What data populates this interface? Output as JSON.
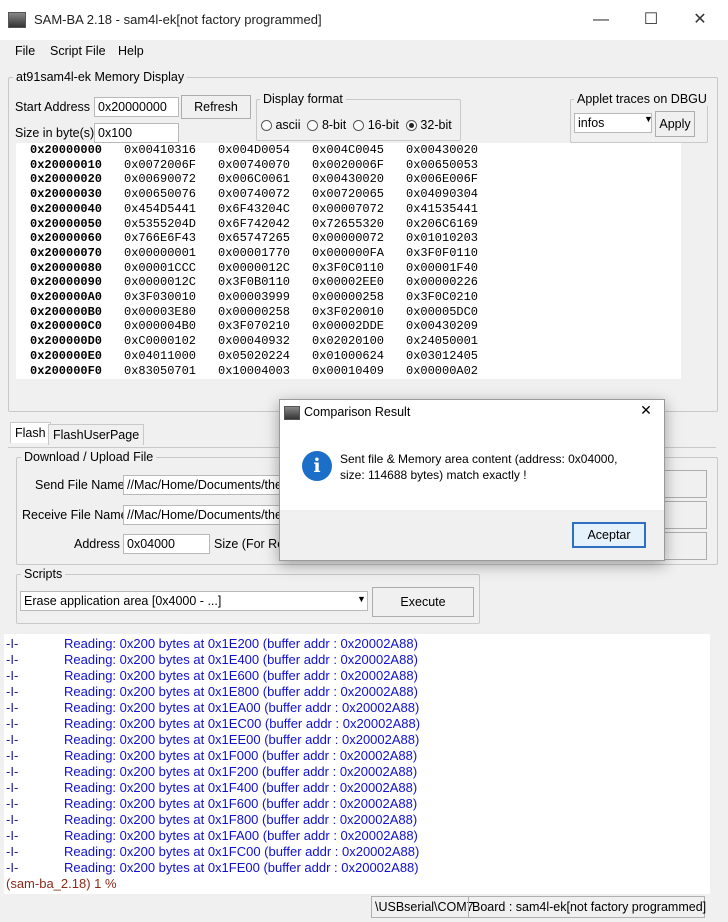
{
  "window": {
    "title": "SAM-BA 2.18  - sam4l-ek[not factory programmed]",
    "minimize_icon": "minimize-icon",
    "maximize_icon": "maximize-icon",
    "close_icon": "close-icon"
  },
  "menu": {
    "file": "File",
    "script_file": "Script File",
    "help": "Help"
  },
  "memory_display": {
    "legend": "at91sam4l-ek Memory Display",
    "start_address_label": "Start Address :",
    "start_address_value": "0x20000000",
    "size_label": "Size in byte(s) :",
    "size_value": "0x100",
    "refresh_label": "Refresh",
    "format_legend": "Display format",
    "formats": [
      "ascii",
      "8-bit",
      "16-bit",
      "32-bit"
    ],
    "selected_format": "32-bit",
    "applet_legend": "Applet traces on DBGU",
    "applet_value": "infos",
    "apply_label": "Apply",
    "rows": [
      {
        "addr": "0x20000000",
        "cells": [
          "0x00410316",
          "0x004D0054",
          "0x004C0045",
          "0x00430020"
        ]
      },
      {
        "addr": "0x20000010",
        "cells": [
          "0x0072006F",
          "0x00740070",
          "0x0020006F",
          "0x00650053"
        ]
      },
      {
        "addr": "0x20000020",
        "cells": [
          "0x00690072",
          "0x006C0061",
          "0x00430020",
          "0x006E006F"
        ]
      },
      {
        "addr": "0x20000030",
        "cells": [
          "0x00650076",
          "0x00740072",
          "0x00720065",
          "0x04090304"
        ]
      },
      {
        "addr": "0x20000040",
        "cells": [
          "0x454D5441",
          "0x6F43204C",
          "0x00007072",
          "0x41535441"
        ]
      },
      {
        "addr": "0x20000050",
        "cells": [
          "0x5355204D",
          "0x6F742042",
          "0x72655320",
          "0x206C6169"
        ]
      },
      {
        "addr": "0x20000060",
        "cells": [
          "0x766E6F43",
          "0x65747265",
          "0x00000072",
          "0x01010203"
        ]
      },
      {
        "addr": "0x20000070",
        "cells": [
          "0x00000001",
          "0x00001770",
          "0x000000FA",
          "0x3F0F0110"
        ]
      },
      {
        "addr": "0x20000080",
        "cells": [
          "0x00001CCC",
          "0x0000012C",
          "0x3F0C0110",
          "0x00001F40"
        ]
      },
      {
        "addr": "0x20000090",
        "cells": [
          "0x0000012C",
          "0x3F0B0110",
          "0x00002EE0",
          "0x00000226"
        ]
      },
      {
        "addr": "0x200000A0",
        "cells": [
          "0x3F030010",
          "0x00003999",
          "0x00000258",
          "0x3F0C0210"
        ]
      },
      {
        "addr": "0x200000B0",
        "cells": [
          "0x00003E80",
          "0x00000258",
          "0x3F020010",
          "0x00005DC0"
        ]
      },
      {
        "addr": "0x200000C0",
        "cells": [
          "0x000004B0",
          "0x3F070210",
          "0x00002DDE",
          "0x00430209"
        ]
      },
      {
        "addr": "0x200000D0",
        "cells": [
          "0xC0000102",
          "0x00040932",
          "0x02020100",
          "0x24050001"
        ]
      },
      {
        "addr": "0x200000E0",
        "cells": [
          "0x04011000",
          "0x05020224",
          "0x01000624",
          "0x03012405"
        ]
      },
      {
        "addr": "0x200000F0",
        "cells": [
          "0x83050701",
          "0x10004003",
          "0x00010409",
          "0x00000A02"
        ]
      }
    ]
  },
  "tabs": [
    "Flash",
    "FlashUserPage"
  ],
  "download": {
    "legend": "Download / Upload File",
    "send_label": "Send File Name :",
    "send_value": "//Mac/Home/Documents/the",
    "receive_label": "Receive File Name :",
    "receive_value": "//Mac/Home/Documents/the",
    "address_label": "Address :",
    "address_value": "0x04000",
    "size_label": "Size (For Rec"
  },
  "scripts": {
    "legend": "Scripts",
    "selected": "Erase application area [0x4000 - ...]",
    "execute_label": "Execute"
  },
  "log": {
    "tag": "-I-",
    "lines": [
      "Reading: 0x200 bytes at 0x1E200 (buffer addr : 0x20002A88)",
      "Reading: 0x200 bytes at 0x1E400 (buffer addr : 0x20002A88)",
      "Reading: 0x200 bytes at 0x1E600 (buffer addr : 0x20002A88)",
      "Reading: 0x200 bytes at 0x1E800 (buffer addr : 0x20002A88)",
      "Reading: 0x200 bytes at 0x1EA00 (buffer addr : 0x20002A88)",
      "Reading: 0x200 bytes at 0x1EC00 (buffer addr : 0x20002A88)",
      "Reading: 0x200 bytes at 0x1EE00 (buffer addr : 0x20002A88)",
      "Reading: 0x200 bytes at 0x1F000 (buffer addr : 0x20002A88)",
      "Reading: 0x200 bytes at 0x1F200 (buffer addr : 0x20002A88)",
      "Reading: 0x200 bytes at 0x1F400 (buffer addr : 0x20002A88)",
      "Reading: 0x200 bytes at 0x1F600 (buffer addr : 0x20002A88)",
      "Reading: 0x200 bytes at 0x1F800 (buffer addr : 0x20002A88)",
      "Reading: 0x200 bytes at 0x1FA00 (buffer addr : 0x20002A88)",
      "Reading: 0x200 bytes at 0x1FC00 (buffer addr : 0x20002A88)",
      "Reading: 0x200 bytes at 0x1FE00 (buffer addr : 0x20002A88)"
    ],
    "prompt": "(sam-ba_2.18) 1 %"
  },
  "status": {
    "port": "\\USBserial\\COM7",
    "board": "Board : sam4l-ek[not factory programmed]"
  },
  "dialog": {
    "title": "Comparison Result",
    "message": "Sent file & Memory area content (address: 0x04000, size: 114688 bytes) match exactly !",
    "ok_label": "Aceptar",
    "icon": "info-icon"
  },
  "colors": {
    "log_text": "#1010d0",
    "prompt_text": "#8b2a1a",
    "dialog_info": "#1c6fc9"
  }
}
